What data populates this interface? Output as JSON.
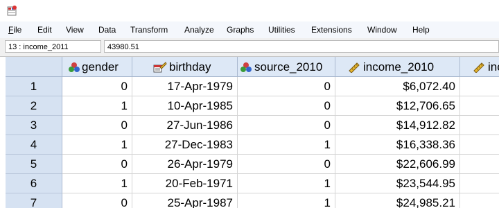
{
  "menu": [
    "File",
    "Edit",
    "View",
    "Data",
    "Transform",
    "Analyze",
    "Graphs",
    "Utilities",
    "Extensions",
    "Window",
    "Help"
  ],
  "menu_mnemonic": [
    "F",
    "E",
    "V",
    "D",
    "T",
    "A",
    "G",
    "U",
    "x",
    "W",
    "H"
  ],
  "cell_ref": "13 : income_2011",
  "cell_value": "43980.51",
  "columns": [
    {
      "name": "gender",
      "icon": "nominal-icon"
    },
    {
      "name": "birthday",
      "icon": "date-scale-icon"
    },
    {
      "name": "source_2010",
      "icon": "nominal-icon"
    },
    {
      "name": "income_2010",
      "icon": "scale-ruler-icon"
    },
    {
      "name": "inc",
      "icon": "scale-ruler-icon"
    }
  ],
  "rows": [
    {
      "n": "1",
      "gender": "0",
      "birthday": "17-Apr-1979",
      "source_2010": "0",
      "income_2010": "$6,072.40"
    },
    {
      "n": "2",
      "gender": "1",
      "birthday": "10-Apr-1985",
      "source_2010": "0",
      "income_2010": "$12,706.65"
    },
    {
      "n": "3",
      "gender": "0",
      "birthday": "27-Jun-1986",
      "source_2010": "0",
      "income_2010": "$14,912.82"
    },
    {
      "n": "4",
      "gender": "1",
      "birthday": "27-Dec-1983",
      "source_2010": "1",
      "income_2010": "$16,338.36"
    },
    {
      "n": "5",
      "gender": "0",
      "birthday": "26-Apr-1979",
      "source_2010": "0",
      "income_2010": "$22,606.99"
    },
    {
      "n": "6",
      "gender": "1",
      "birthday": "20-Feb-1971",
      "source_2010": "1",
      "income_2010": "$23,544.95"
    },
    {
      "n": "7",
      "gender": "0",
      "birthday": "25-Apr-1987",
      "source_2010": "1",
      "income_2010": "$24,985.21"
    }
  ]
}
